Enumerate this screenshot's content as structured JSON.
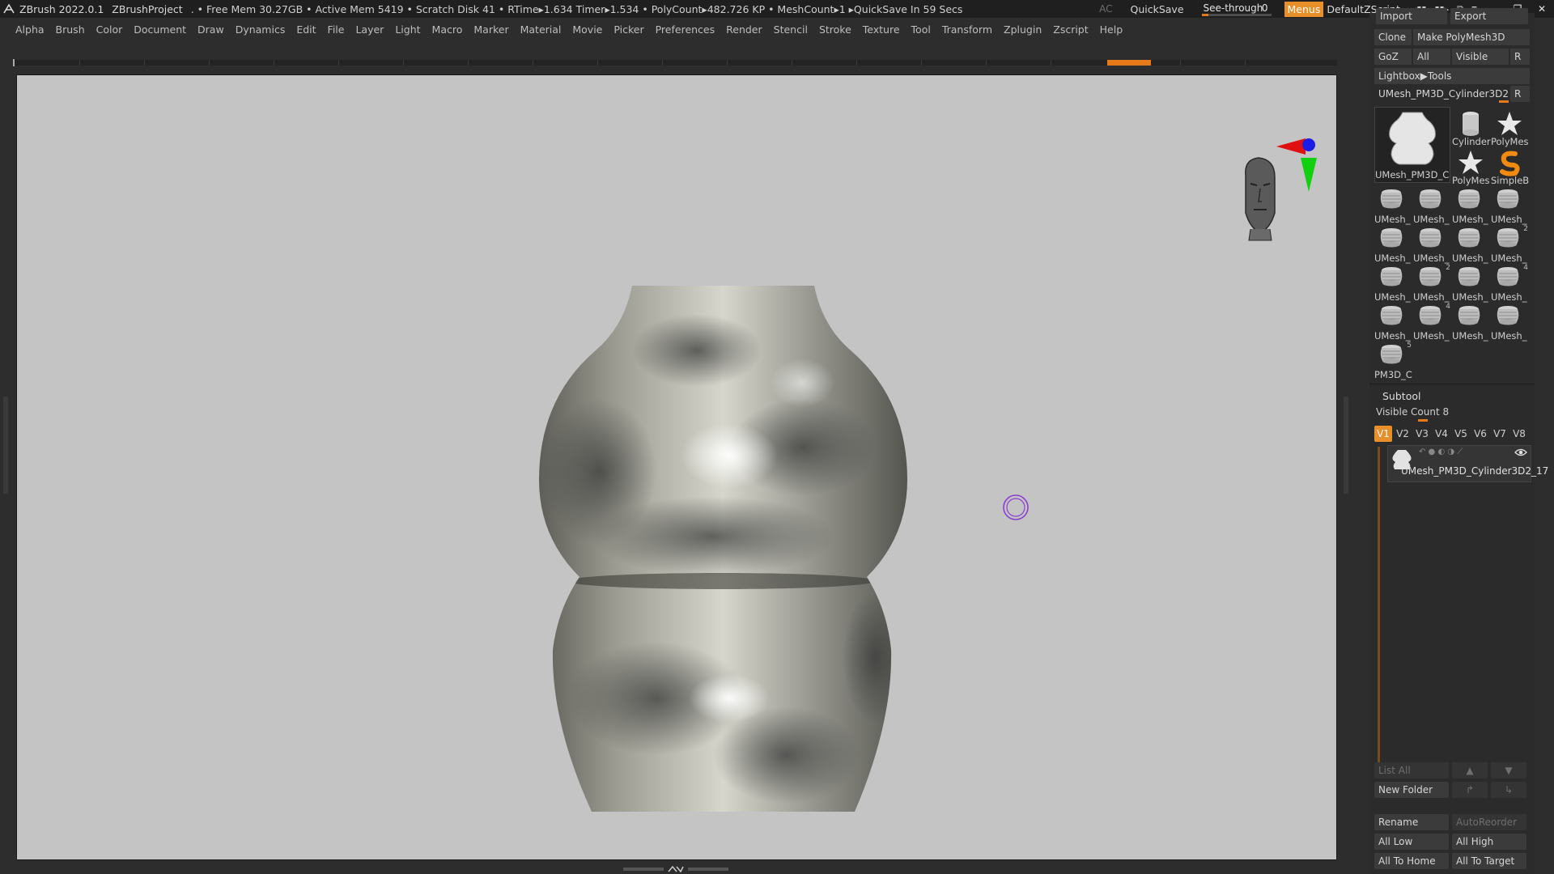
{
  "titlebar": {
    "app": "ZBrush 2022.0.1",
    "project": "ZBrushProject",
    "stats": ". • Free Mem 30.27GB • Active Mem 5419 • Scratch Disk 41 •  RTime▸1.634 Timer▸1.534 • PolyCount▸482.726 KP  • MeshCount▸1   ▸QuickSave In 59 Secs",
    "ac": "AC",
    "quicksave": "QuickSave",
    "seethrough_label": "See-through",
    "seethrough_value": "0",
    "seethrough_level": 0.0,
    "menus": "Menus",
    "default_zscript": "DefaultZScript"
  },
  "menubar": {
    "items": [
      "Alpha",
      "Brush",
      "Color",
      "Document",
      "Draw",
      "Dynamics",
      "Edit",
      "File",
      "Layer",
      "Light",
      "Macro",
      "Marker",
      "Material",
      "Movie",
      "Picker",
      "Preferences",
      "Render",
      "Stencil",
      "Stroke",
      "Texture",
      "Tool",
      "Transform",
      "Zplugin",
      "Zscript",
      "Help"
    ]
  },
  "tool_panel": {
    "import": "Import",
    "export": "Export",
    "clone": "Clone",
    "make_polymesh": "Make PolyMesh3D",
    "goz": "GoZ",
    "all": "All",
    "visible": "Visible",
    "r": "R",
    "lightbox_tools": "Lightbox▶Tools",
    "current_tool": "UMesh_PM3D_Cylinder3D2_1",
    "current_tool_r": "R",
    "big_thumb_caption": "UMesh_PM3D_C",
    "small_thumbs": [
      {
        "caption": "Cylinder"
      },
      {
        "caption": "PolyMes"
      },
      {
        "caption": "PolyMes"
      },
      {
        "caption": "SimpleB"
      }
    ],
    "grid_thumbs": [
      {
        "caption": "UMesh_",
        "badge": ""
      },
      {
        "caption": "UMesh_",
        "badge": ""
      },
      {
        "caption": "UMesh_",
        "badge": ""
      },
      {
        "caption": "UMesh_",
        "badge": ""
      },
      {
        "caption": "UMesh_",
        "badge": ""
      },
      {
        "caption": "UMesh_",
        "badge": ""
      },
      {
        "caption": "UMesh_",
        "badge": ""
      },
      {
        "caption": "UMesh_",
        "badge": "2"
      },
      {
        "caption": "UMesh_",
        "badge": ""
      },
      {
        "caption": "UMesh_",
        "badge": "2"
      },
      {
        "caption": "UMesh_",
        "badge": ""
      },
      {
        "caption": "UMesh_",
        "badge": "4"
      },
      {
        "caption": "UMesh_",
        "badge": ""
      },
      {
        "caption": "UMesh_",
        "badge": "4"
      },
      {
        "caption": "UMesh_",
        "badge": ""
      },
      {
        "caption": "UMesh_",
        "badge": ""
      },
      {
        "caption": "PM3D_C",
        "badge": "5"
      }
    ]
  },
  "subtool": {
    "title": "Subtool",
    "visible_count": "Visible Count 8",
    "visible_tabs": [
      "V1",
      "V2",
      "V3",
      "V4",
      "V5",
      "V6",
      "V7",
      "V8"
    ],
    "item_name": "UMesh_PM3D_Cylinder3D2_17",
    "list_all": "List All",
    "new_folder": "New Folder",
    "rename": "Rename",
    "auto_reorder": "AutoReorder",
    "all_low": "All Low",
    "all_high": "All High",
    "all_to_home": "All To Home",
    "all_to_target": "All To Target"
  },
  "colors": {
    "accent": "#e98f2a",
    "viewport_bg": "#c4c4c4",
    "ui_bg": "#2d2d2d"
  }
}
